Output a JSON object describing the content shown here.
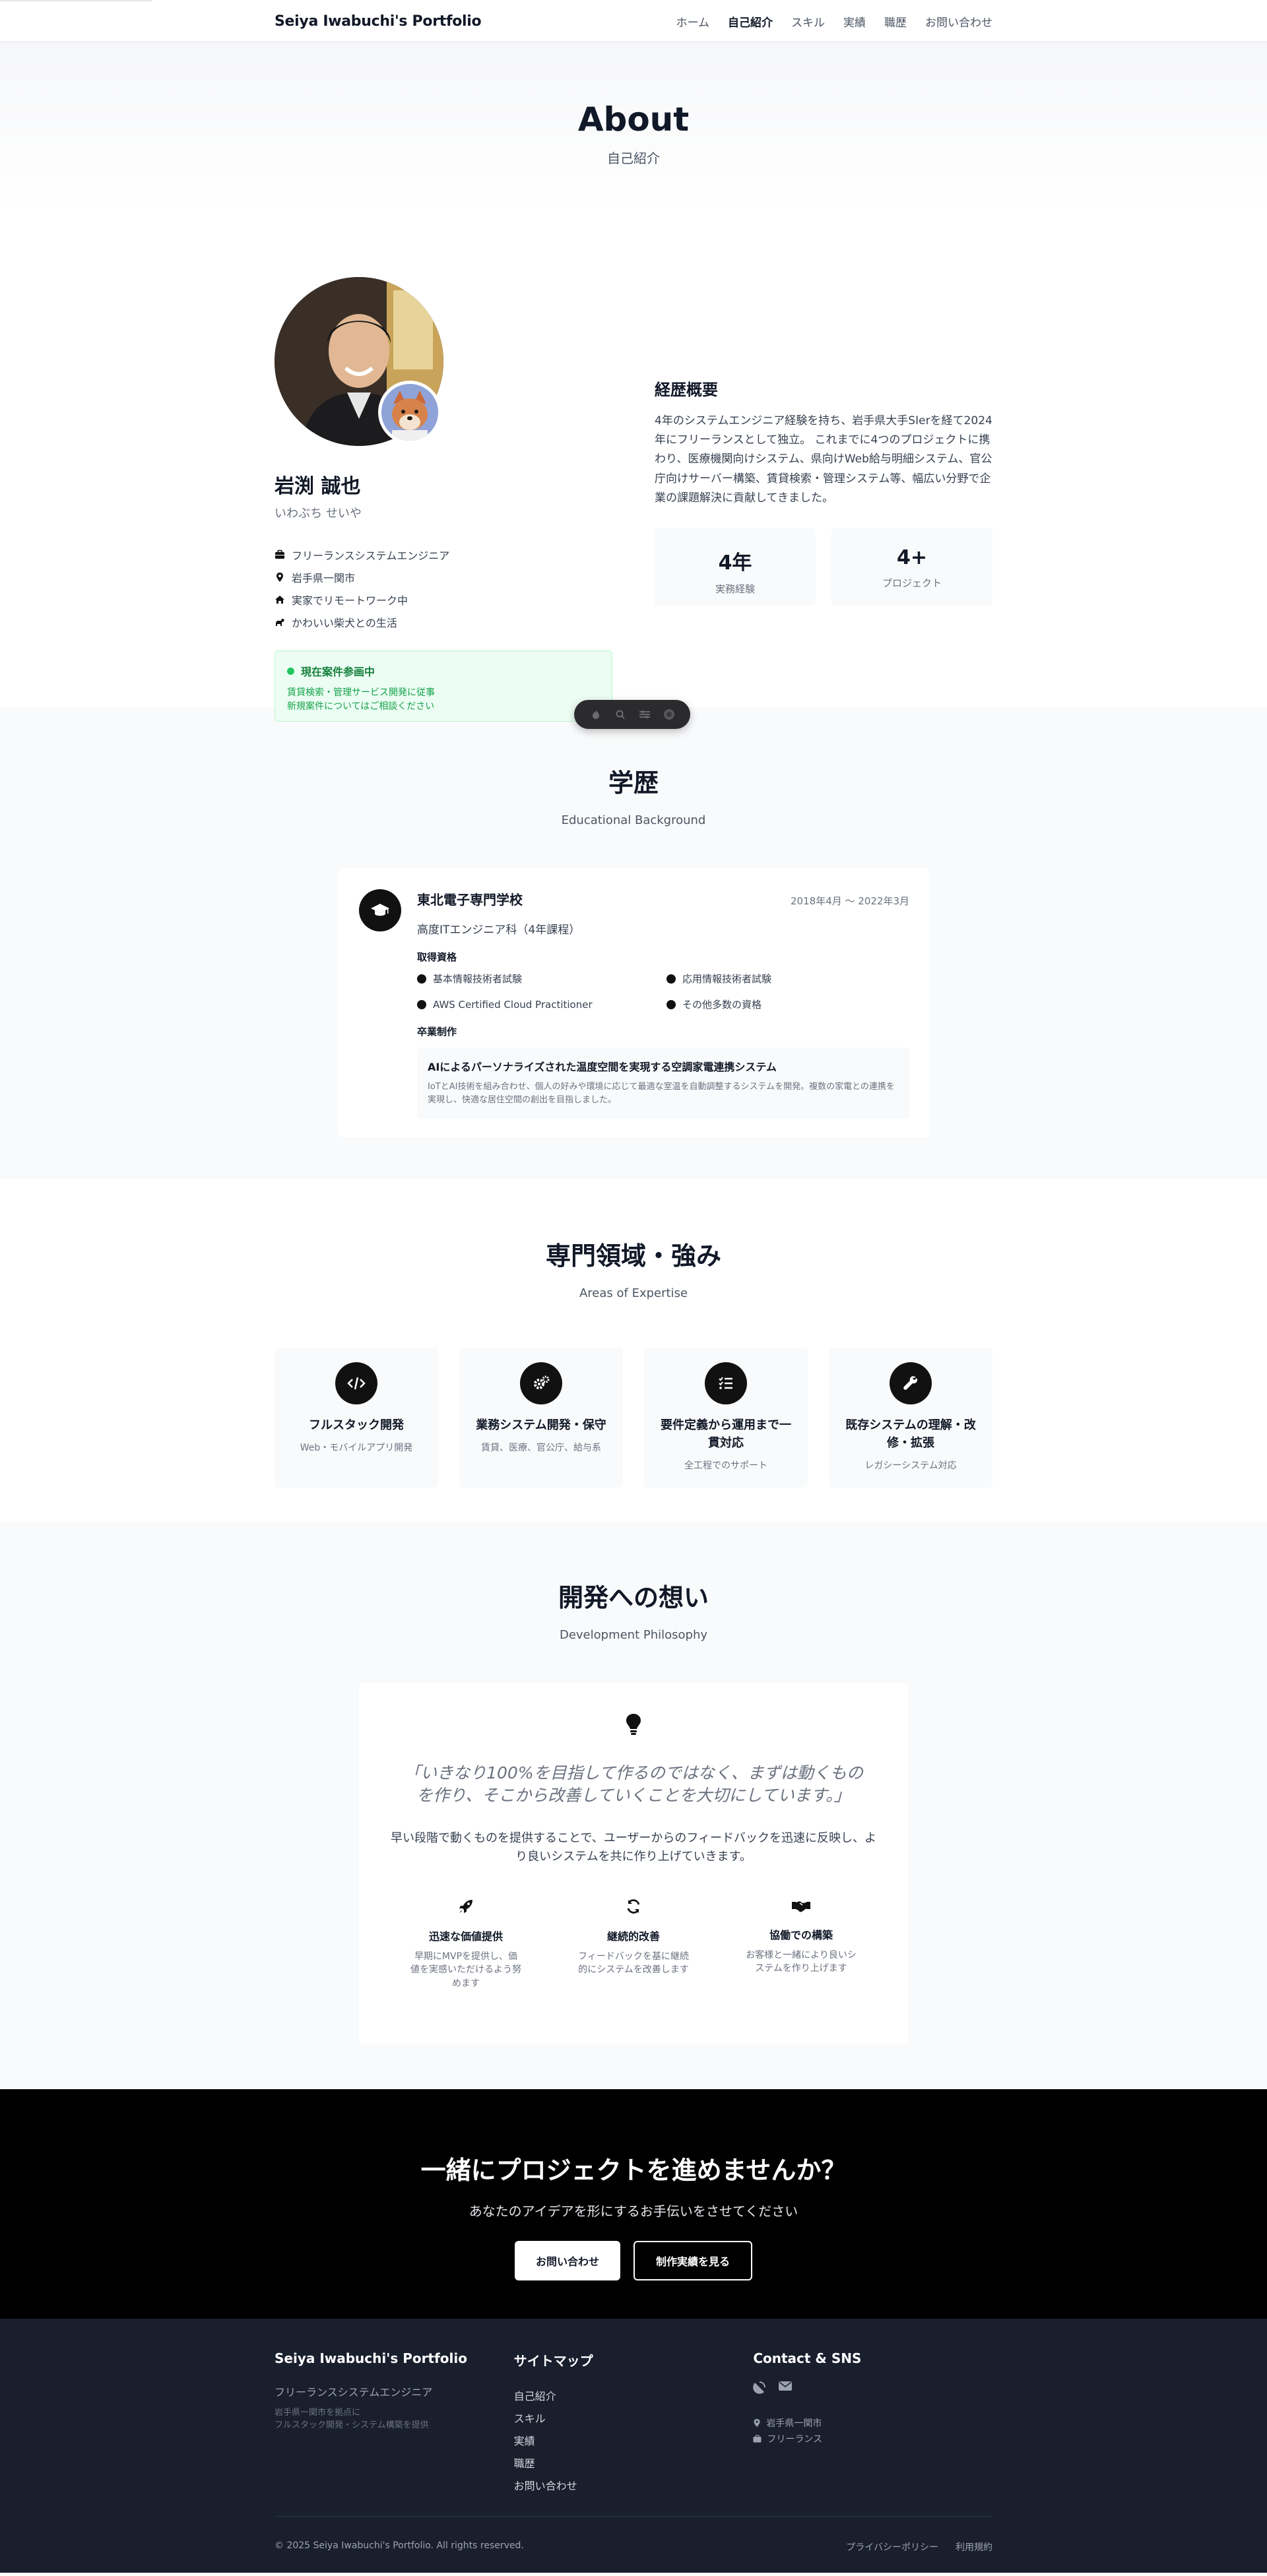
{
  "header": {
    "brand": "Seiya Iwabuchi's Portfolio",
    "nav": [
      "ホーム",
      "自己紹介",
      "スキル",
      "実績",
      "職歴",
      "お問い合わせ"
    ],
    "active_nav": "自己紹介"
  },
  "hero": {
    "title": "About",
    "subtitle": "自己紹介"
  },
  "profile": {
    "name": "岩渕 誠也",
    "kana": "いわぶち せいや",
    "facts": [
      {
        "icon": "briefcase-icon",
        "text": "フリーランスシステムエンジニア"
      },
      {
        "icon": "map-pin-icon",
        "text": "岩手県一関市"
      },
      {
        "icon": "home-icon",
        "text": "実家でリモートワーク中"
      },
      {
        "icon": "dog-icon",
        "text": "かわいい柴犬との生活"
      }
    ],
    "status": {
      "title": "現在案件参画中",
      "lines": [
        "賃貸検索・管理サービス開発に従事",
        "新規案件についてはご相談ください"
      ]
    }
  },
  "career": {
    "heading": "経歴概要",
    "summary": "4年のシステムエンジニア経験を持ち、岩手県大手SIerを経て2024年にフリーランスとして独立。 これまでに4つのプロジェクトに携わり、医療機関向けシステム、県向けWeb給与明細システム、官公庁向けサーバー構築、賃貸検索・管理システム等、幅広い分野で企業の課題解決に貢献してきました。",
    "stats": [
      {
        "value": "4年",
        "label": "実務経験"
      },
      {
        "value": "4+",
        "label": "プロジェクト"
      }
    ]
  },
  "education": {
    "title": "学歴",
    "subtitle": "Educational Background",
    "school": "東北電子専門学校",
    "period": "2018年4月 〜 2022年3月",
    "course": "高度ITエンジニア科（4年課程）",
    "qualifications_label": "取得資格",
    "qualifications": [
      "基本情報技術者試験",
      "応用情報技術者試験",
      "AWS Certified Cloud Practitioner",
      "その他多数の資格"
    ],
    "graduation_label": "卒業制作",
    "project_title": "AIによるパーソナライズされた温度空間を実現する空調家電連携システム",
    "project_desc": "IoTとAI技術を組み合わせ、個人の好みや環境に応じて最適な室温を自動調整するシステムを開発。複数の家電との連携を実現し、快適な居住空間の創出を目指しました。"
  },
  "expertise": {
    "title": "専門領域・強み",
    "subtitle": "Areas of Expertise",
    "items": [
      {
        "icon": "code-icon",
        "title": "フルスタック開発",
        "sub": "Web・モバイルアプリ開発"
      },
      {
        "icon": "cogs-icon",
        "title": "業務システム開発・保守",
        "sub": "賃貸、医療、官公庁、給与系"
      },
      {
        "icon": "tasks-icon",
        "title": "要件定義から運用まで一貫対応",
        "sub": "全工程でのサポート"
      },
      {
        "icon": "wrench-icon",
        "title": "既存システムの理解・改修・拡張",
        "sub": "レガシーシステム対応"
      }
    ]
  },
  "philosophy": {
    "title": "開発への想い",
    "subtitle": "Development Philosophy",
    "quote": "「いきなり100%を目指して作るのではなく、まずは動くものを作り、そこから改善していくことを大切にしています。」",
    "text": "早い段階で動くものを提供することで、ユーザーからのフィードバックを迅速に反映し、より良いシステムを共に作り上げていきます。",
    "principles": [
      {
        "icon": "rocket-icon",
        "title": "迅速な価値提供",
        "desc": "早期にMVPを提供し、価値を実感いただけるよう努めます"
      },
      {
        "icon": "sync-icon",
        "title": "継続的改善",
        "desc": "フィードバックを基に継続的にシステムを改善します"
      },
      {
        "icon": "handshake-icon",
        "title": "協働での構築",
        "desc": "お客様と一緒により良いシステムを作り上げます"
      }
    ]
  },
  "cta": {
    "title": "一緒にプロジェクトを進めませんか？",
    "subtitle": "あなたのアイデアを形にするお手伝いをさせてください",
    "primary": "お問い合わせ",
    "secondary": "制作実績を見る"
  },
  "footer": {
    "brand": "Seiya Iwabuchi's Portfolio",
    "role": "フリーランスシステムエンジニア",
    "desc_lines": [
      "岩手県一関市を拠点に",
      "フルスタック開発・システム構築を提供"
    ],
    "sitemap_title": "サイトマップ",
    "sitemap": [
      "自己紹介",
      "スキル",
      "実績",
      "職歴",
      "お問い合わせ"
    ],
    "contact_title": "Contact & SNS",
    "location": "岩手県一関市",
    "work_style": "フリーランス",
    "copyright": "© 2025 Seiya Iwabuchi's Portfolio. All rights reserved.",
    "legal": [
      "プライバシーポリシー",
      "利用規約"
    ]
  },
  "colors": {
    "accent": "#111111",
    "status_green": "#22c55e",
    "footer_bg": "#1a1f2e",
    "cta_bg": "#000000"
  }
}
